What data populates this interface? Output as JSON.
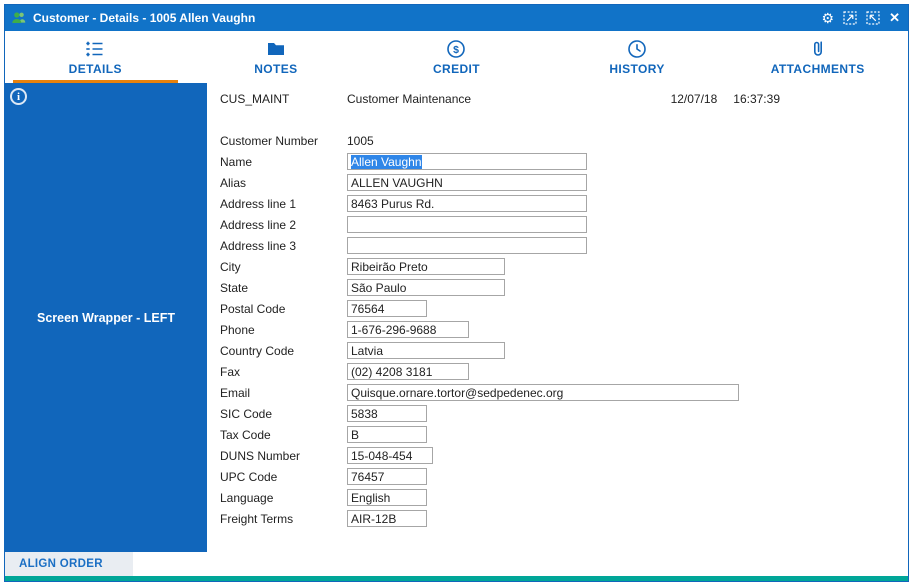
{
  "window": {
    "title": "Customer - Details - 1005 Allen Vaughn"
  },
  "icons": {
    "titlebar_left": "users-icon",
    "titlebar_right": [
      "gear-icon",
      "resize-screen-icon",
      "fit-screen-icon",
      "close-icon"
    ],
    "tab_icons": [
      "form-details-icon",
      "folder-icon",
      "dollar-circle-icon",
      "clock-icon",
      "paperclip-icon"
    ],
    "sidebar": "info-icon"
  },
  "colors": {
    "titlebar_blue": "#1173c8",
    "sidebar_blue": "#1166bb",
    "tab_text_blue": "#1166bb",
    "active_tab_underline_orange": "#e8820c",
    "bottom_strip_teal": "#00a698",
    "selection_blue": "#2f86e8",
    "align_order_bg": "#e9edf2"
  },
  "tabs": [
    {
      "label": "DETAILS",
      "active": true
    },
    {
      "label": "NOTES",
      "active": false
    },
    {
      "label": "CREDIT",
      "active": false
    },
    {
      "label": "HISTORY",
      "active": false
    },
    {
      "label": "ATTACHMENTS",
      "active": false
    }
  ],
  "sidebar": {
    "label": "Screen Wrapper - LEFT",
    "footer_link": "ALIGN ORDER"
  },
  "header": {
    "program": "CUS_MAINT",
    "title": "Customer Maintenance",
    "date": "12/07/18",
    "time": "16:37:39"
  },
  "form": {
    "fields": [
      {
        "label": "Customer Number",
        "value": "1005"
      },
      {
        "label": "Name",
        "value": "Allen Vaughn"
      },
      {
        "label": "Alias",
        "value": "ALLEN VAUGHN"
      },
      {
        "label": "Address line 1",
        "value": "8463 Purus Rd."
      },
      {
        "label": "Address line 2",
        "value": ""
      },
      {
        "label": "Address line 3",
        "value": ""
      },
      {
        "label": "City",
        "value": "Ribeirão Preto"
      },
      {
        "label": "State",
        "value": "São Paulo"
      },
      {
        "label": "Postal Code",
        "value": "76564"
      },
      {
        "label": "Phone",
        "value": "1-676-296-9688"
      },
      {
        "label": "Country Code",
        "value": "Latvia"
      },
      {
        "label": "Fax",
        "value": "(02) 4208 3181"
      },
      {
        "label": "Email",
        "value": "Quisque.ornare.tortor@sedpedenec.org"
      },
      {
        "label": "SIC Code",
        "value": "5838"
      },
      {
        "label": "Tax Code",
        "value": "B"
      },
      {
        "label": "DUNS Number",
        "value": "15-048-454"
      },
      {
        "label": "UPC Code",
        "value": "76457"
      },
      {
        "label": "Language",
        "value": "English"
      },
      {
        "label": "Freight Terms",
        "value": "AIR-12B"
      }
    ]
  }
}
